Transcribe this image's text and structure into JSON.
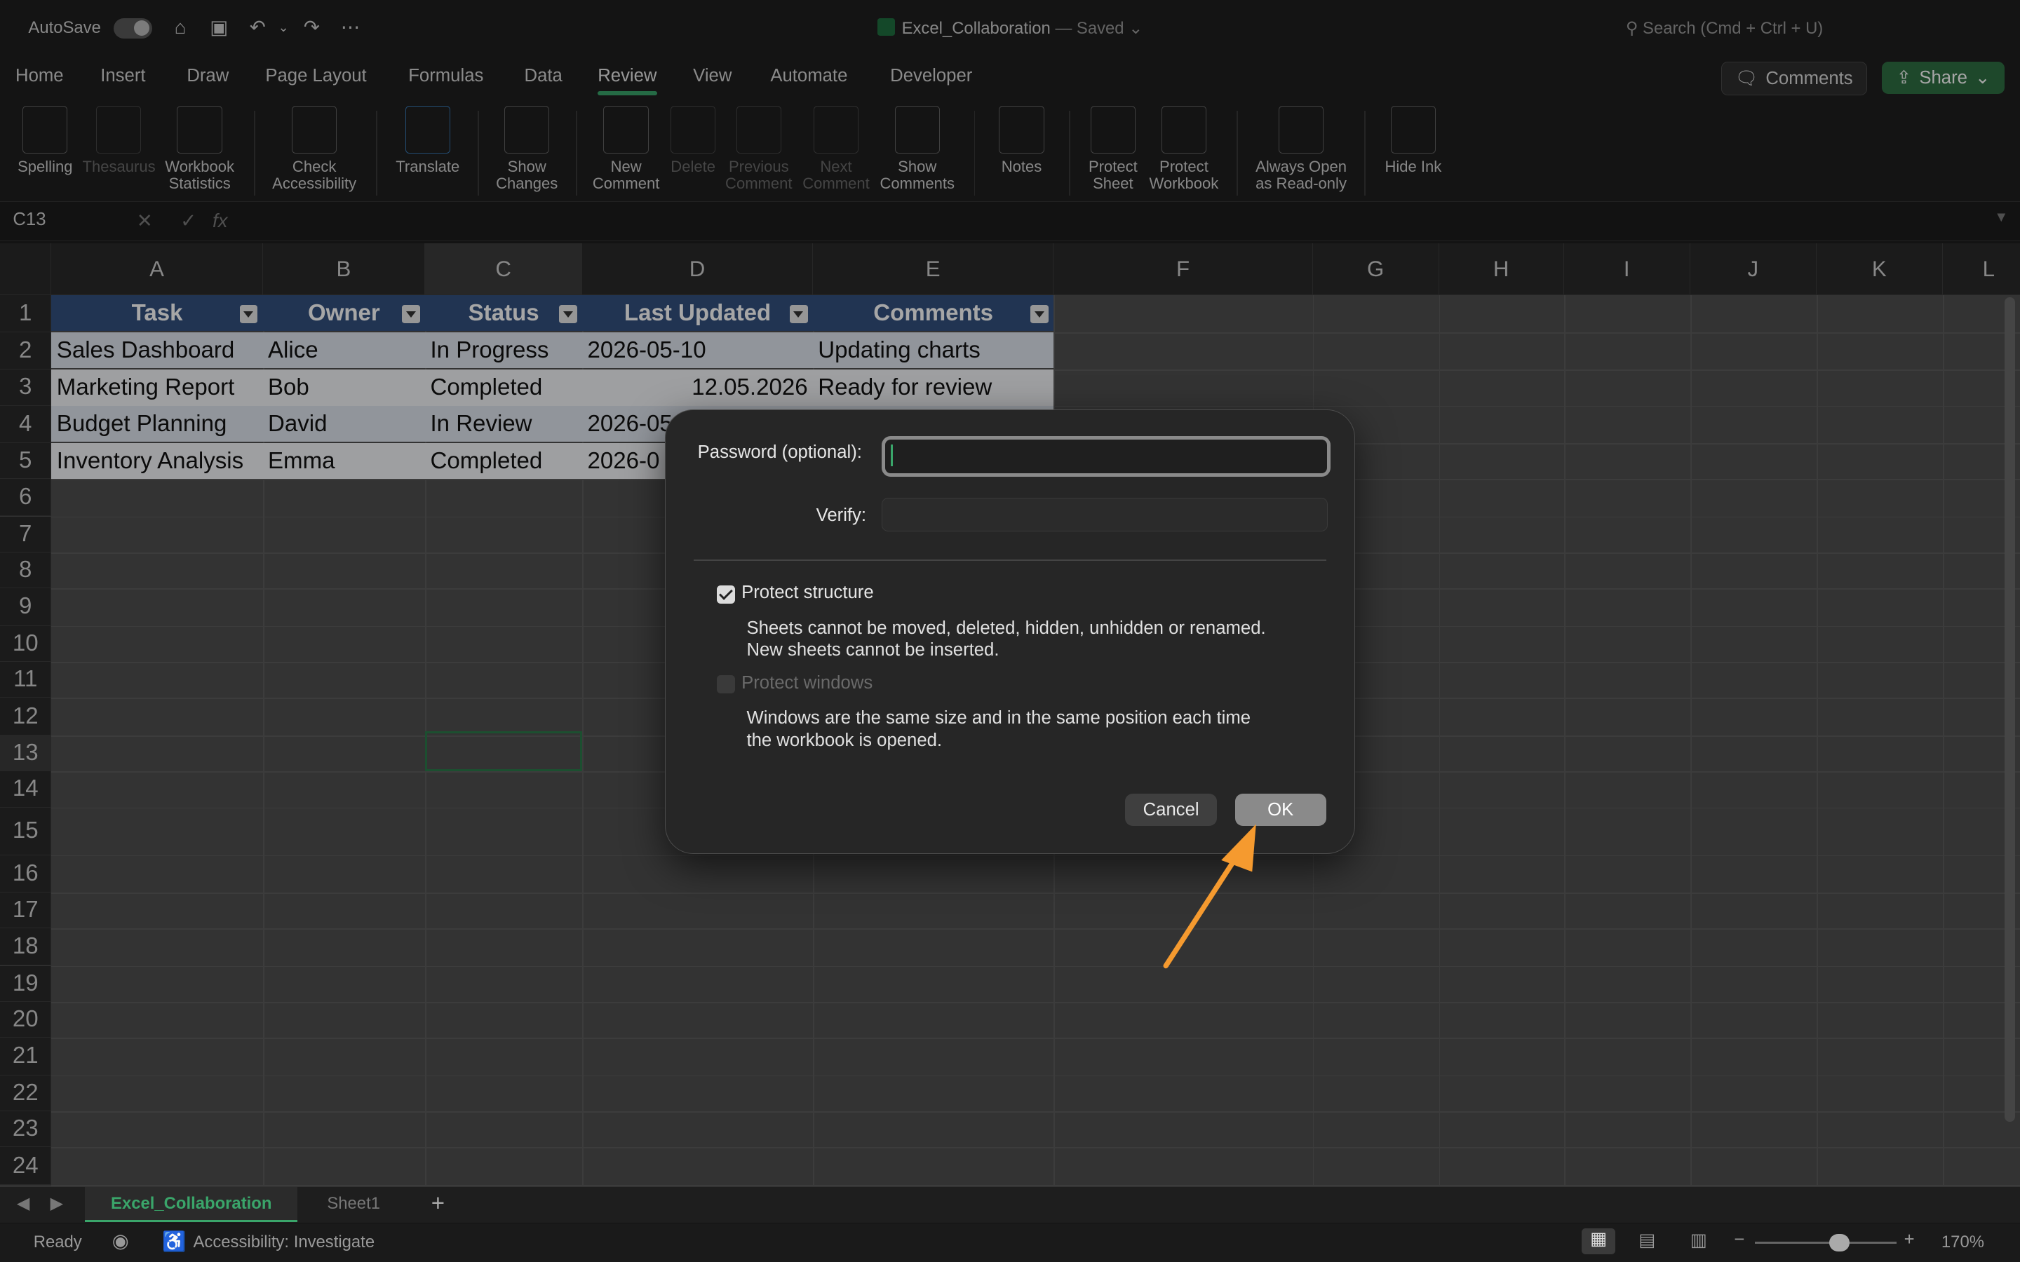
{
  "titlebar": {
    "autosave_label": "AutoSave",
    "doc_title": "Excel_Collaboration",
    "doc_status": "— Saved",
    "search_placeholder": "Search (Cmd + Ctrl + U)"
  },
  "menu_tabs": [
    "Home",
    "Insert",
    "Draw",
    "Page Layout",
    "Formulas",
    "Data",
    "Review",
    "View",
    "Automate",
    "Developer"
  ],
  "active_tab": "Review",
  "header_buttons": {
    "comments": "Comments",
    "share": "Share"
  },
  "ribbon": {
    "spelling": "Spelling",
    "thesaurus": "Thesaurus",
    "workbook_statistics_1": "Workbook",
    "workbook_statistics_2": "Statistics",
    "check_accessibility_1": "Check",
    "check_accessibility_2": "Accessibility",
    "translate": "Translate",
    "show_changes_1": "Show",
    "show_changes_2": "Changes",
    "new_comment_1": "New",
    "new_comment_2": "Comment",
    "delete": "Delete",
    "previous_comment_1": "Previous",
    "previous_comment_2": "Comment",
    "next_comment_1": "Next",
    "next_comment_2": "Comment",
    "show_comments_1": "Show",
    "show_comments_2": "Comments",
    "notes": "Notes",
    "protect_sheet_1": "Protect",
    "protect_sheet_2": "Sheet",
    "protect_workbook_1": "Protect",
    "protect_workbook_2": "Workbook",
    "always_open_1": "Always Open",
    "always_open_2": "as Read-only",
    "hide_ink": "Hide Ink"
  },
  "formula_bar": {
    "name_box": "C13",
    "fx": "fx"
  },
  "columns": [
    "A",
    "B",
    "C",
    "D",
    "E",
    "F",
    "G",
    "H",
    "I",
    "J",
    "K",
    "L"
  ],
  "rows": [
    "1",
    "2",
    "3",
    "4",
    "5",
    "6",
    "7",
    "8",
    "9",
    "10",
    "11",
    "12",
    "13",
    "14",
    "15",
    "16",
    "17",
    "18",
    "19",
    "20",
    "21",
    "22",
    "23",
    "24"
  ],
  "table": {
    "headers": [
      "Task",
      "Owner",
      "Status",
      "Last Updated",
      "Comments"
    ],
    "rows": [
      [
        "Sales Dashboard",
        "Alice",
        "In Progress",
        "2026-05-10",
        "Updating charts"
      ],
      [
        "Marketing Report",
        "Bob",
        "Completed",
        "12.05.2026",
        "Ready for review"
      ],
      [
        "Budget Planning",
        "David",
        "In Review",
        "2026-05",
        ""
      ],
      [
        "Inventory Analysis",
        "Emma",
        "Completed",
        "2026-0",
        ""
      ]
    ]
  },
  "sheet_tabs": [
    "Excel_Collaboration",
    "Sheet1"
  ],
  "status": {
    "ready": "Ready",
    "accessibility": "Accessibility: Investigate",
    "zoom": "170%"
  },
  "dialog": {
    "password_label": "Password (optional):",
    "verify_label": "Verify:",
    "protect_structure_label": "Protect structure",
    "protect_structure_checked": true,
    "protect_structure_desc_1": "Sheets cannot be moved, deleted, hidden, unhidden or renamed.",
    "protect_structure_desc_2": "New sheets cannot be inserted.",
    "protect_windows_label": "Protect windows",
    "protect_windows_checked": false,
    "protect_windows_desc_1": "Windows are the same size and in the same position each time",
    "protect_windows_desc_2": "the workbook is opened.",
    "cancel": "Cancel",
    "ok": "OK"
  },
  "colors": {
    "accent": "#3aa56a",
    "table_header": "#34507e",
    "annotation_arrow": "#f59a2f"
  }
}
